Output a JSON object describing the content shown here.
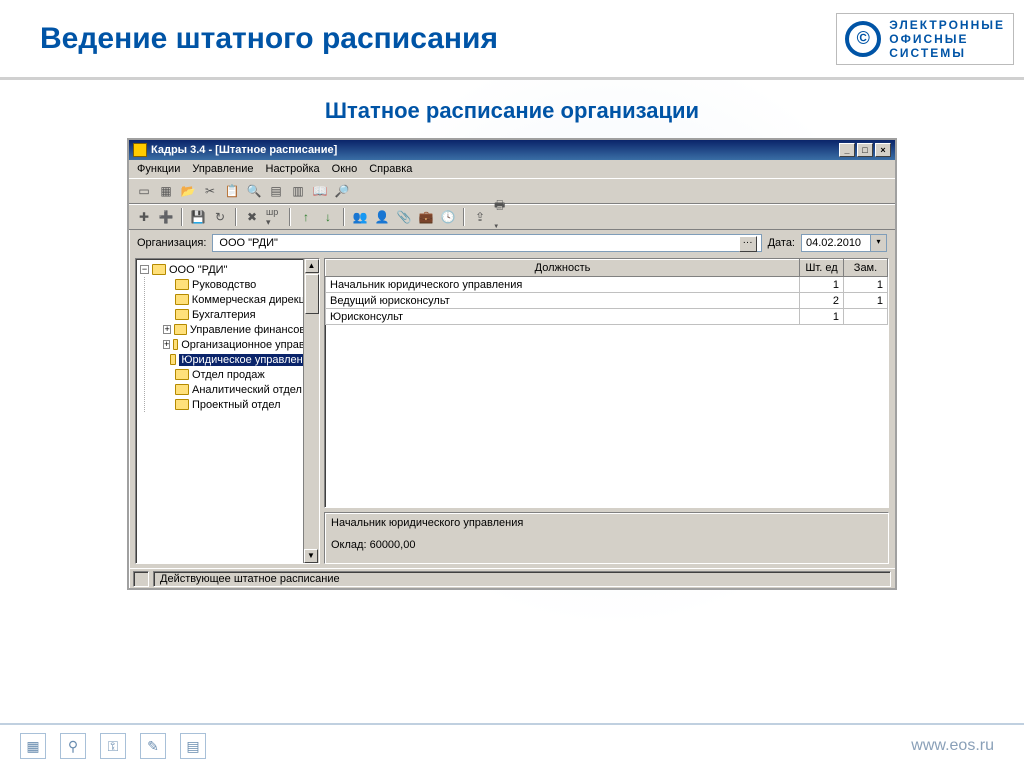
{
  "slide": {
    "title": "Ведение штатного расписания",
    "subtitle": "Штатное расписание организации",
    "footer_url": "www.eos.ru"
  },
  "logo": {
    "l1": "ЭЛЕКТРОННЫЕ",
    "l2": "ОФИСНЫЕ",
    "l3": "СИСТЕМЫ"
  },
  "window": {
    "title": "Кадры 3.4 - [Штатное расписание]"
  },
  "menu": {
    "functions": "Функции",
    "manage": "Управление",
    "settings": "Настройка",
    "window": "Окно",
    "help": "Справка"
  },
  "filter": {
    "org_label": "Организация:",
    "org_value": "ООО \"РДИ\"",
    "date_label": "Дата:",
    "date_value": "04.02.2010"
  },
  "tree": {
    "root": "ООО \"РДИ\"",
    "items": [
      "Руководство",
      "Коммерческая дирекция",
      "Бухгалтерия",
      "Управление финансовов",
      "Организационное управле",
      "Юридическое управление",
      "Отдел продаж",
      "Аналитический отдел",
      "Проектный отдел"
    ],
    "selected_index": 5,
    "expandable": [
      3,
      4
    ]
  },
  "table": {
    "headers": {
      "position": "Должность",
      "units": "Шт. ед",
      "sub": "Зам."
    },
    "rows": [
      {
        "position": "Начальник юридического управления",
        "units": "1",
        "sub": "1"
      },
      {
        "position": "Ведущий юрисконсульт",
        "units": "2",
        "sub": "1"
      },
      {
        "position": "Юрисконсульт",
        "units": "1",
        "sub": ""
      }
    ]
  },
  "detail": {
    "title": "Начальник юридического управления",
    "salary_label": "Оклад:",
    "salary_value": "60000,00"
  },
  "status": {
    "text": "Действующее штатное расписание"
  }
}
